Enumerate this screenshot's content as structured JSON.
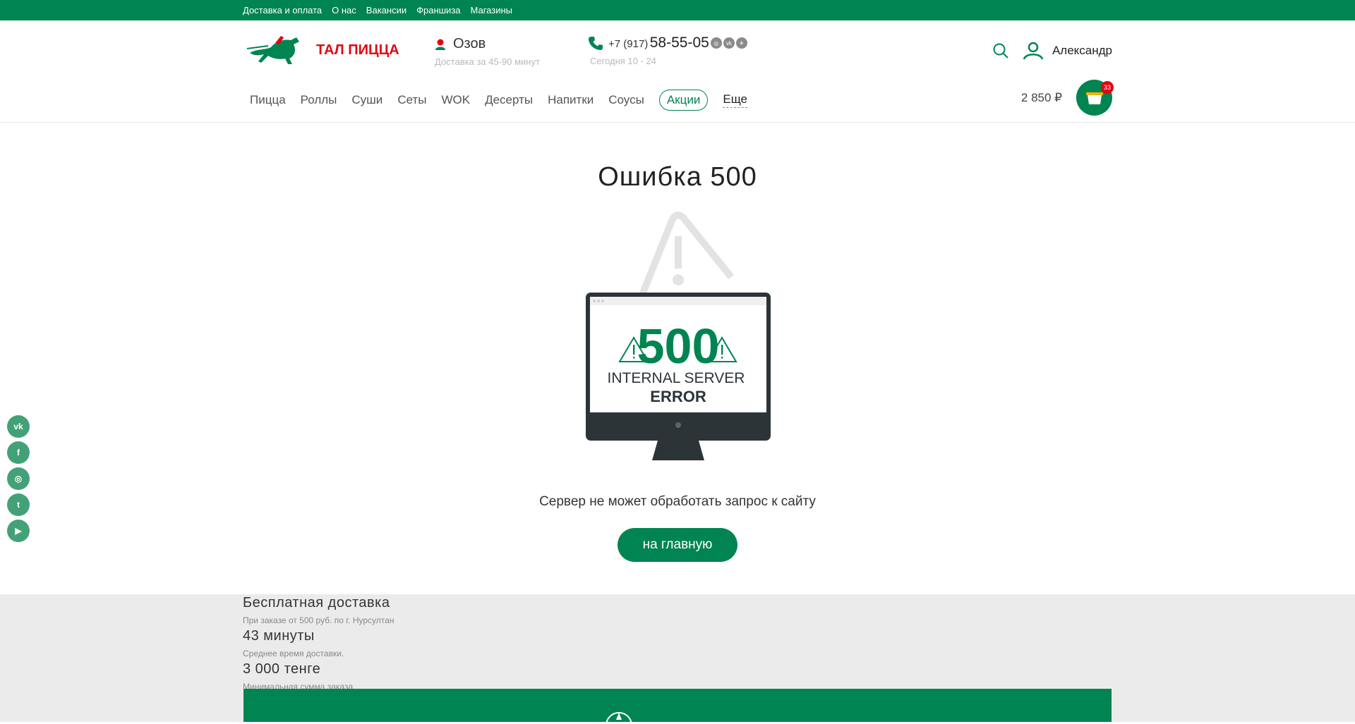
{
  "topnav": [
    "Доставка и оплата",
    "О нас",
    "Вакансии",
    "Франшиза",
    "Магазины"
  ],
  "logo": {
    "text": "ТАЛ ПИЦЦА"
  },
  "city": {
    "name": "Озов",
    "sub": "Доставка за 45-90 минут"
  },
  "phone": {
    "code": "+7 (917)",
    "number": "58-55-05",
    "hours": "Сегодня 10 - 24"
  },
  "phone_socials": [
    "instagram-icon",
    "vk-icon",
    "tg-icon"
  ],
  "user": {
    "name": "Александр"
  },
  "menu": {
    "items": [
      "Пицца",
      "Роллы",
      "Суши",
      "Сеты",
      "WOK",
      "Десерты",
      "Напитки",
      "Соусы"
    ],
    "promo": "Акции",
    "more": "Еще"
  },
  "cart": {
    "total": "2 850 ₽",
    "count": "33"
  },
  "error": {
    "title": "Ошибка 500",
    "code": "500",
    "line1": "INTERNAL SERVER",
    "line2": "ERROR",
    "message": "Сервер не может обработать запрос к сайту",
    "button": "на главную"
  },
  "side_social": [
    "vk",
    "f",
    "ig",
    "tw",
    "yt"
  ],
  "footer": {
    "items": [
      {
        "title": "Бесплатная доставка",
        "sub": "При заказе от 500 руб. по г. Нурсултан"
      },
      {
        "title": "43 минуты",
        "sub": "Среднее время доставки."
      },
      {
        "title": "3 000 тенге",
        "sub": "Минимальная сумма заказа"
      }
    ]
  },
  "colors": {
    "brand": "#008451",
    "accent": "#e30613",
    "muted": "#b9b9b9"
  }
}
